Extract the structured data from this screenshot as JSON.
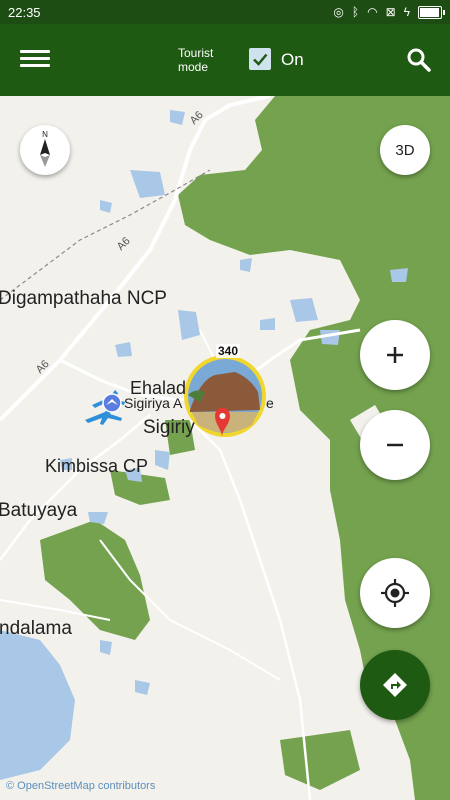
{
  "status": {
    "time": "22:35"
  },
  "toolbar": {
    "tourist_label_1": "Tourist",
    "tourist_label_2": "mode",
    "on_label": "On"
  },
  "controls": {
    "compass": "N",
    "three_d": "3D"
  },
  "map_labels": {
    "region_1": "Digampathaha NCP",
    "village_1": "Ehalad",
    "airport": "Sigiriya A",
    "airport_tail": "e",
    "town": "Sigiriy",
    "region_2": "Kimbissa CP",
    "village_2": "Batuyaya",
    "village_3": "ndalama",
    "road_a6_1": "A6",
    "road_a6_2": "A6",
    "road_a6_3": "A6"
  },
  "poi": {
    "count": "340"
  },
  "credit": "© OpenStreetMap contributors",
  "colors": {
    "toolbar": "#1f5a13",
    "forest": "#74a24e",
    "water": "#a9c7e6",
    "accent": "#f1d62e"
  }
}
